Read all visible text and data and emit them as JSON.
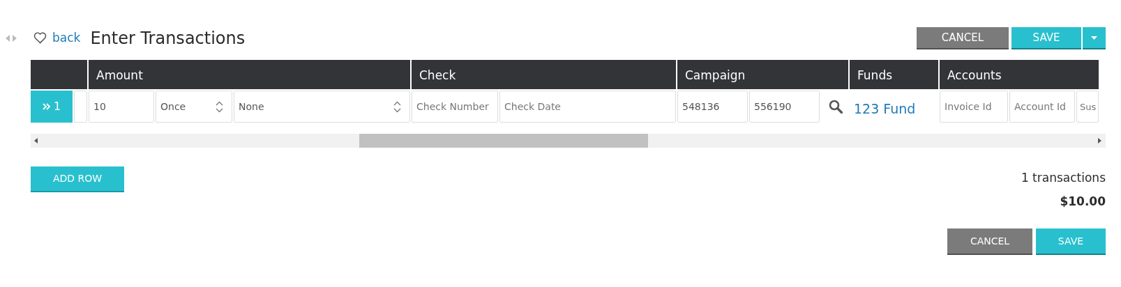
{
  "header": {
    "back_link": "back",
    "title": "Enter Transactions",
    "buttons": [
      {
        "kind": "cancel",
        "label": "CANCEL"
      },
      {
        "kind": "save",
        "label": "SAVE"
      }
    ]
  },
  "table": {
    "columns": [
      "Amount",
      "Check",
      "Campaign",
      "Funds",
      "Accounts"
    ],
    "rows": [
      {
        "number": "1",
        "selected": true,
        "groups": [
          [
            {
              "kind": "input",
              "value": "10"
            },
            {
              "kind": "select",
              "value": "Once"
            },
            {
              "kind": "select",
              "value": "None"
            }
          ],
          [
            {
              "kind": "input",
              "placeholder": "Check Number"
            },
            {
              "kind": "input",
              "placeholder": "Check Date"
            }
          ],
          [
            {
              "kind": "input",
              "value": "548136"
            },
            {
              "kind": "input",
              "value": "556190"
            },
            {
              "kind": "search"
            }
          ],
          [
            {
              "kind": "link",
              "value": "123 Fund"
            }
          ],
          [
            {
              "kind": "input",
              "placeholder": "Invoice Id"
            },
            {
              "kind": "input",
              "placeholder": "Account Id"
            },
            {
              "kind": "input",
              "placeholder": "Sus"
            }
          ]
        ]
      }
    ]
  },
  "add_row": "ADD ROW",
  "summary": {
    "count": "1 transactions",
    "total": "$10.00"
  },
  "footer_buttons": [
    {
      "kind": "cancel",
      "label": "CANCEL"
    },
    {
      "kind": "save",
      "label": "SAVE"
    }
  ]
}
